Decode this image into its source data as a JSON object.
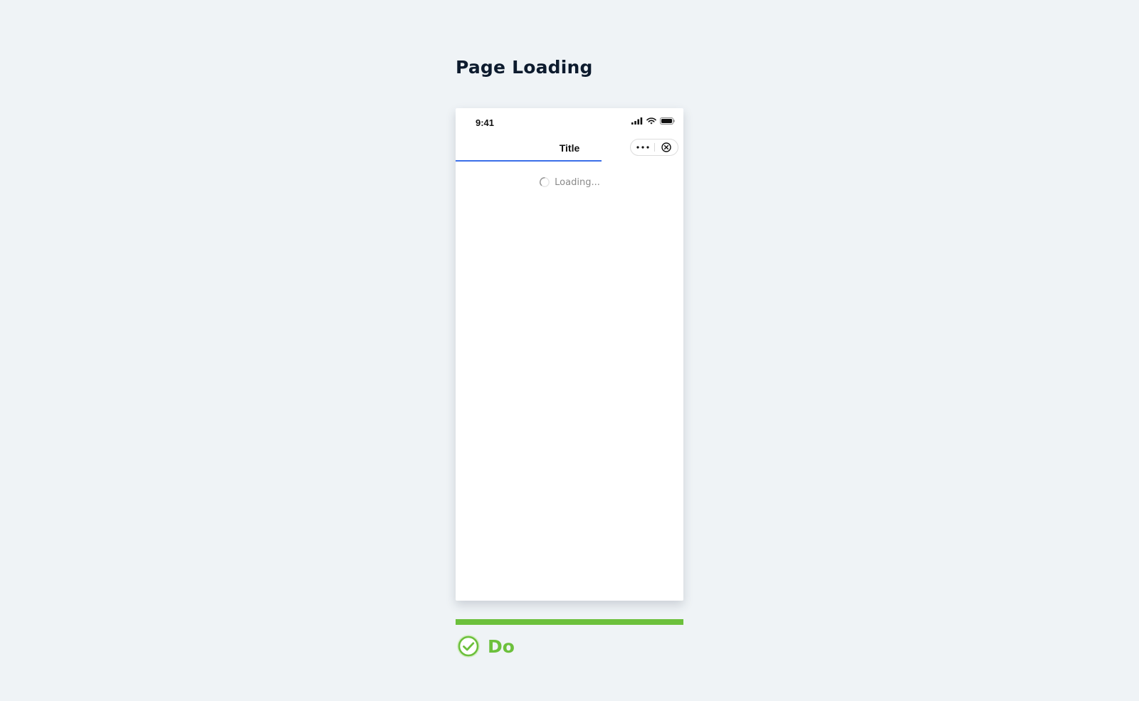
{
  "page": {
    "title": "Page Loading"
  },
  "phone": {
    "status_bar": {
      "time": "9:41",
      "icons": [
        "signal-icon",
        "wifi-icon",
        "battery-icon"
      ]
    },
    "nav_bar": {
      "title": "Title",
      "capsule": {
        "more_icon": "more-dots-icon",
        "close_icon": "close-circle-icon"
      }
    },
    "progress": {
      "value": 0.64,
      "color": "#3a6ee8"
    },
    "loading": {
      "text": "Loading...",
      "icon": "spinner-icon"
    }
  },
  "verdict": {
    "label": "Do",
    "icon": "check-circle-icon",
    "color": "#6cc03c"
  }
}
